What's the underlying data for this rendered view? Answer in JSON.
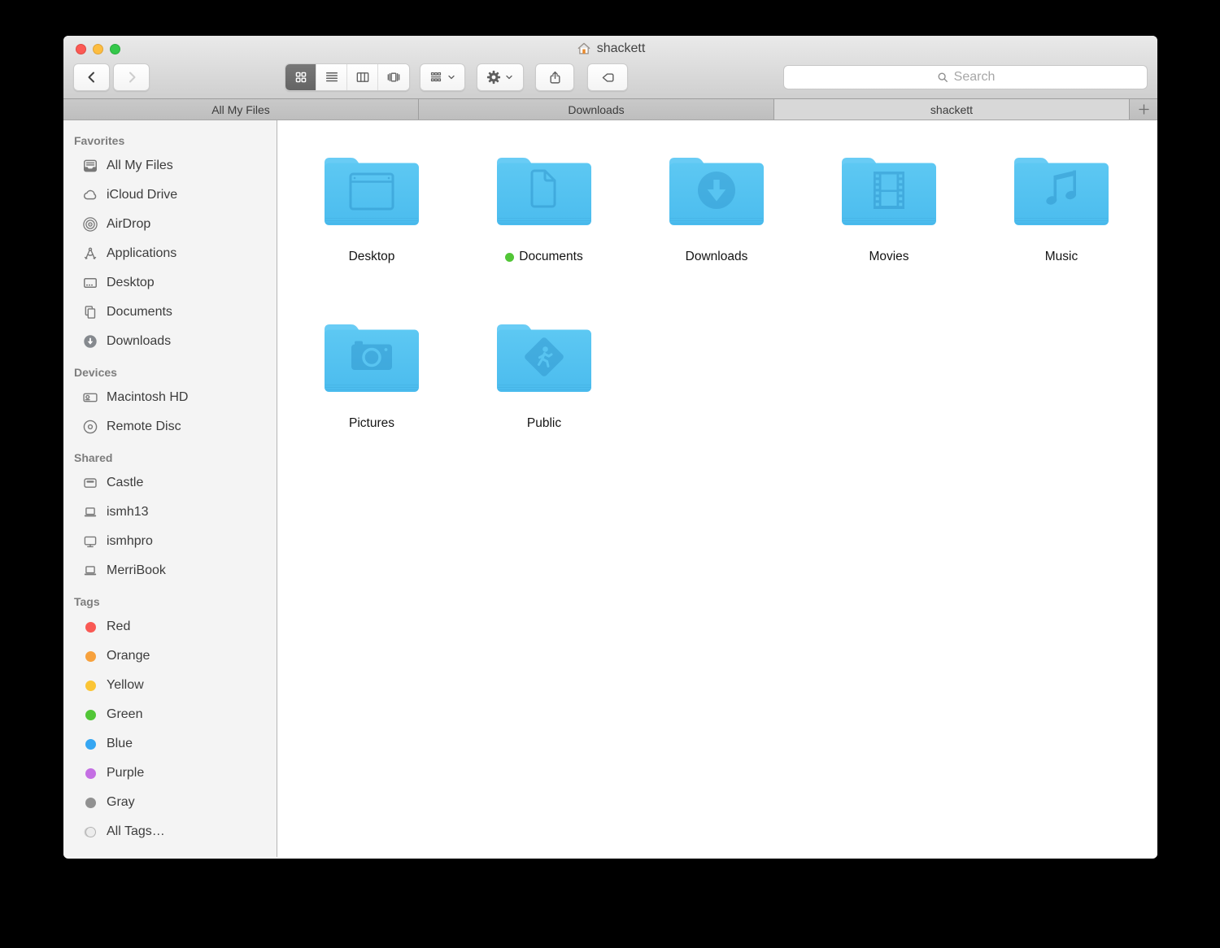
{
  "window": {
    "title": "shackett",
    "title_icon": "home-icon"
  },
  "traffic_lights": [
    {
      "name": "close-button",
      "color": "#fc5954"
    },
    {
      "name": "minimize-button",
      "color": "#fdbd40"
    },
    {
      "name": "zoom-button",
      "color": "#34c84a"
    }
  ],
  "toolbar": {
    "back_enabled": true,
    "forward_enabled": false,
    "view_modes": [
      {
        "name": "icon-view",
        "icon": "grid-view-icon",
        "active": true
      },
      {
        "name": "list-view",
        "icon": "list-view-icon",
        "active": false
      },
      {
        "name": "column-view",
        "icon": "column-view-icon",
        "active": false
      },
      {
        "name": "coverflow-view",
        "icon": "coverflow-view-icon",
        "active": false
      }
    ],
    "arrange_icon": "arrange-icon",
    "action_icon": "gear-icon",
    "share_icon": "share-icon",
    "tag_icon": "tag-icon",
    "search_placeholder": "Search"
  },
  "tabs": [
    {
      "label": "All My Files",
      "active": false
    },
    {
      "label": "Downloads",
      "active": false
    },
    {
      "label": "shackett",
      "active": true
    }
  ],
  "new_tab_label": "+",
  "sidebar": {
    "sections": [
      {
        "title": "Favorites",
        "items": [
          {
            "label": "All My Files",
            "icon": "all-my-files-icon"
          },
          {
            "label": "iCloud Drive",
            "icon": "icloud-icon"
          },
          {
            "label": "AirDrop",
            "icon": "airdrop-icon"
          },
          {
            "label": "Applications",
            "icon": "applications-icon"
          },
          {
            "label": "Desktop",
            "icon": "desktop-icon"
          },
          {
            "label": "Documents",
            "icon": "documents-icon"
          },
          {
            "label": "Downloads",
            "icon": "downloads-circle-icon"
          }
        ]
      },
      {
        "title": "Devices",
        "items": [
          {
            "label": "Macintosh HD",
            "icon": "hard-drive-icon"
          },
          {
            "label": "Remote Disc",
            "icon": "disc-icon"
          }
        ]
      },
      {
        "title": "Shared",
        "items": [
          {
            "label": "Castle",
            "icon": "time-capsule-icon"
          },
          {
            "label": "ismh13",
            "icon": "laptop-icon"
          },
          {
            "label": "ismhpro",
            "icon": "display-icon"
          },
          {
            "label": "MerriBook",
            "icon": "laptop-icon"
          }
        ]
      },
      {
        "title": "Tags",
        "items": [
          {
            "label": "Red",
            "dot": "#f95954"
          },
          {
            "label": "Orange",
            "dot": "#f7a13d"
          },
          {
            "label": "Yellow",
            "dot": "#fbc535"
          },
          {
            "label": "Green",
            "dot": "#52c637"
          },
          {
            "label": "Blue",
            "dot": "#35a6f2"
          },
          {
            "label": "Purple",
            "dot": "#c46fe3"
          },
          {
            "label": "Gray",
            "dot": "#919191"
          },
          {
            "label": "All Tags…",
            "dot": "hollow"
          }
        ]
      }
    ]
  },
  "content": {
    "folders": [
      {
        "label": "Desktop",
        "glyph": "desktop"
      },
      {
        "label": "Documents",
        "glyph": "document",
        "tag": "#52c637"
      },
      {
        "label": "Downloads",
        "glyph": "download"
      },
      {
        "label": "Movies",
        "glyph": "movies"
      },
      {
        "label": "Music",
        "glyph": "music"
      },
      {
        "label": "Pictures",
        "glyph": "camera"
      },
      {
        "label": "Public",
        "glyph": "public"
      }
    ],
    "folder_color_top": "#5dc8f3",
    "folder_color_bottom": "#4bbcee",
    "folder_tab_color": "#69ccf5",
    "folder_glyph_color": "#2e94cc"
  }
}
